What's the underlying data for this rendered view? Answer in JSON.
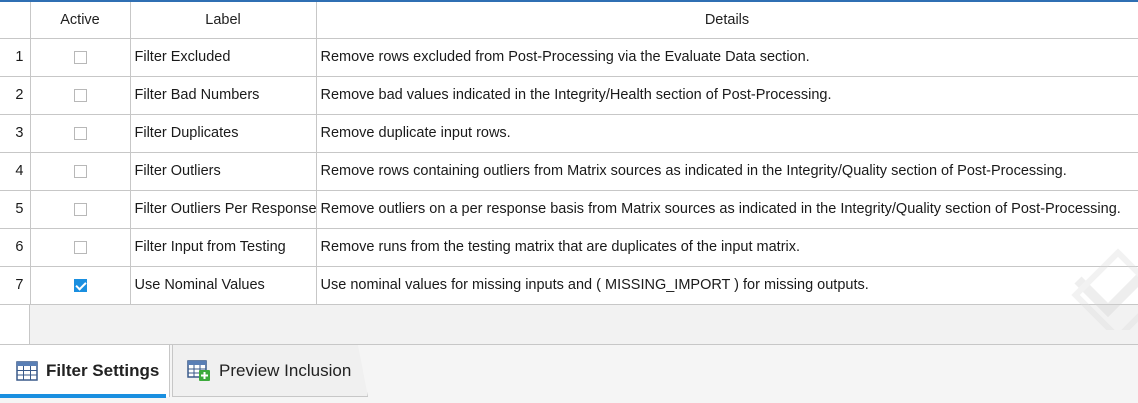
{
  "columns": {
    "row_header": "",
    "active": "Active",
    "label": "Label",
    "details": "Details"
  },
  "rows": [
    {
      "index": "1",
      "active": false,
      "label": "Filter Excluded",
      "details": "Remove rows excluded from Post-Processing via the Evaluate Data section."
    },
    {
      "index": "2",
      "active": false,
      "label": "Filter Bad Numbers",
      "details": "Remove bad values indicated in the Integrity/Health section of Post-Processing."
    },
    {
      "index": "3",
      "active": false,
      "label": "Filter Duplicates",
      "details": "Remove duplicate input rows."
    },
    {
      "index": "4",
      "active": false,
      "label": "Filter Outliers",
      "details": "Remove rows containing outliers from Matrix sources as indicated in the Integrity/Quality section of Post-Processing."
    },
    {
      "index": "5",
      "active": false,
      "label": "Filter Outliers Per Response",
      "details": "Remove outliers on a per response basis from Matrix sources as indicated in the Integrity/Quality section of Post-Processing."
    },
    {
      "index": "6",
      "active": false,
      "label": "Filter Input from Testing",
      "details": "Remove runs from the testing matrix that are duplicates of the input matrix."
    },
    {
      "index": "7",
      "active": true,
      "label": "Use Nominal Values",
      "details": "Use nominal values for missing inputs and ( MISSING_IMPORT ) for missing outputs."
    }
  ],
  "tabs": [
    {
      "label": "Filter Settings",
      "icon": "table-grid-icon",
      "active": true
    },
    {
      "label": "Preview Inclusion",
      "icon": "table-add-icon",
      "active": false
    }
  ],
  "colors": {
    "accent": "#1a8fe0",
    "top_border": "#2f6fb3",
    "grid_line": "#c7c7c7"
  }
}
